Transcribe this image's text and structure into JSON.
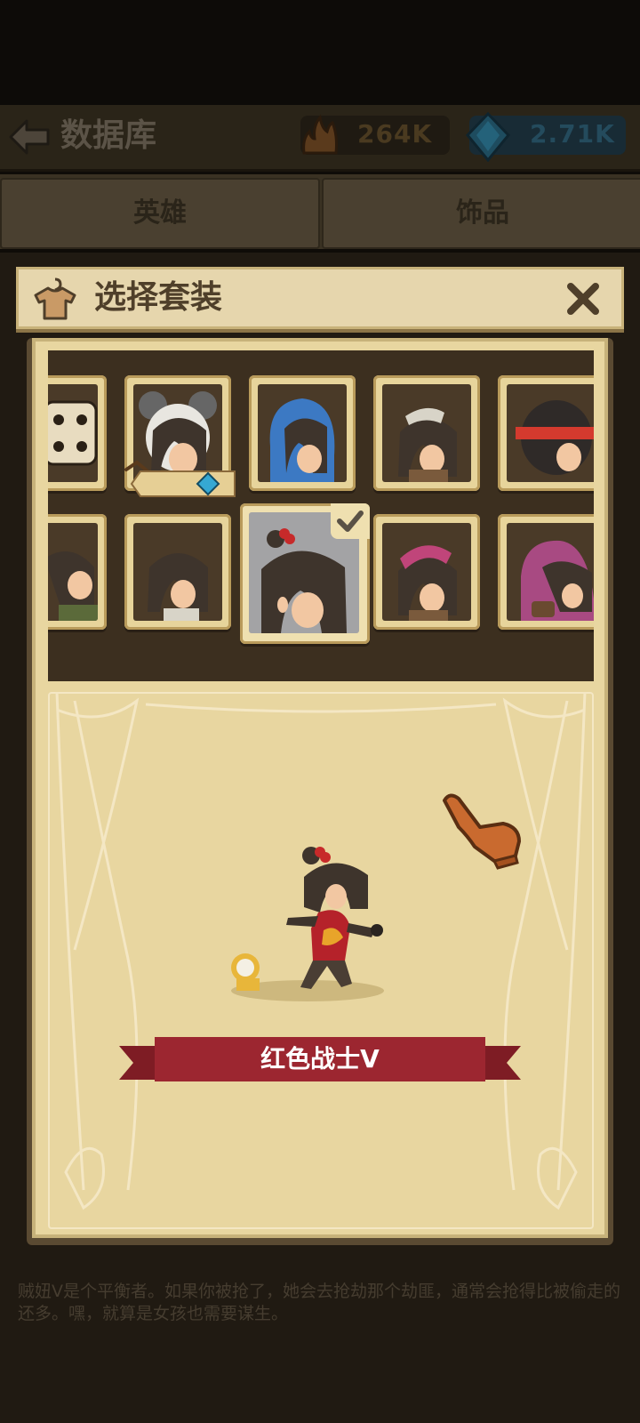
{
  "header": {
    "title": "数据库",
    "flame_value": "264K",
    "gem_value": "2.71K"
  },
  "tabs": {
    "heroes": "英雄",
    "accessories": "饰品"
  },
  "dialog": {
    "title": "选择套装",
    "selected_outfit": "红色战士V"
  },
  "outfits_row1": [
    "dice-head",
    "mouse-hood",
    "blue-hood",
    "bandage",
    "red-headband"
  ],
  "outfits_row2": [
    "green-shirt",
    "bandage-plain",
    "red-warrior",
    "pink-bandana",
    "pink-hood"
  ],
  "description": "贼妞V是个平衡者。如果你被抢了，她会去抢劫那个劫匪，通常会抢得比被偷走的还多。嘿，就算是女孩也需要谋生。",
  "colors": {
    "banner": "#9c2630",
    "panel": "#e8d6a0",
    "grid_bg": "#3c2f1f",
    "gem": "#35a8d3"
  }
}
